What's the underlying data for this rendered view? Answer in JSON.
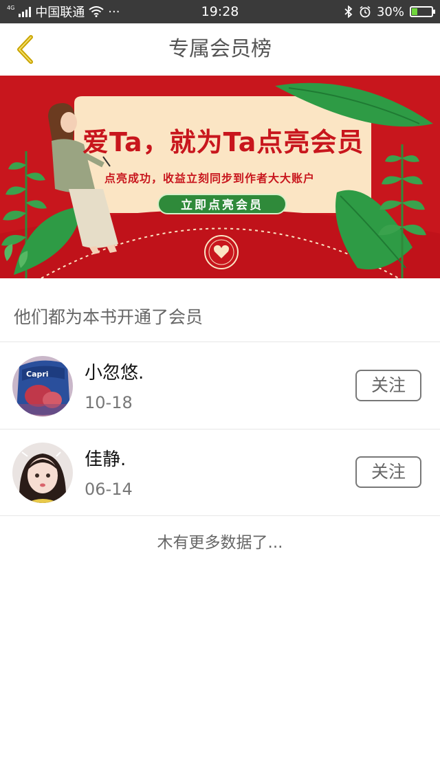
{
  "status_bar": {
    "network": "4G",
    "carrier": "中国联通",
    "more": "···",
    "time": "19:28",
    "battery_text": "30%",
    "battery_level": 0.3
  },
  "header": {
    "title": "专属会员榜"
  },
  "banner": {
    "headline": "爱Ta，就为Ta点亮会员",
    "subtitle": "点亮成功，收益立刻同步到作者大大账户",
    "cta": "立即点亮会员"
  },
  "section_title": "他们都为本书开通了会员",
  "members": [
    {
      "name": "小忽悠.",
      "date": "10-18",
      "follow_label": "关注",
      "avatar": "avatar-snack-photo"
    },
    {
      "name": "佳静.",
      "date": "06-14",
      "follow_label": "关注",
      "avatar": "avatar-girl-photo"
    }
  ],
  "footer_note": "木有更多数据了...",
  "colors": {
    "status_bar_bg": "#3a3a3a",
    "banner_red": "#c8161d",
    "cta_green": "#2f8a3a",
    "back_icon": "#c9a400"
  }
}
